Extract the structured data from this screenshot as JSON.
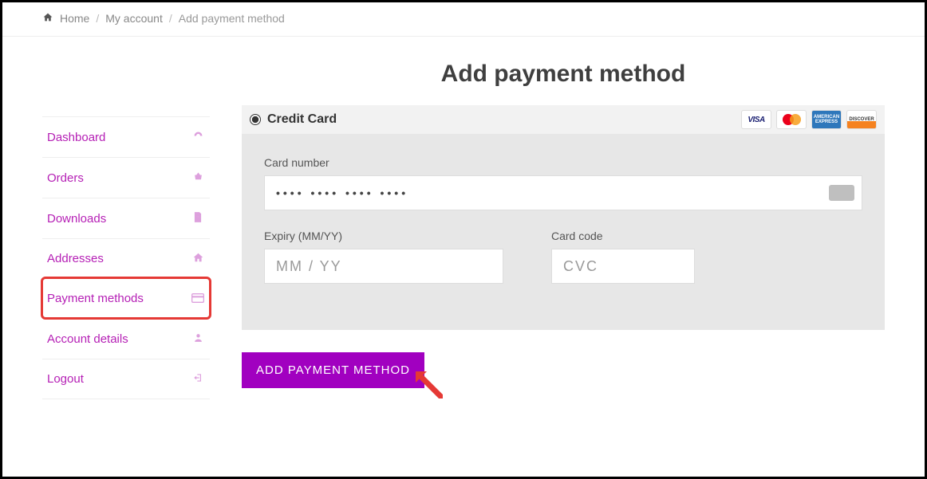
{
  "breadcrumb": {
    "home": "Home",
    "account": "My account",
    "current": "Add payment method"
  },
  "sidebar": {
    "items": [
      {
        "label": "Dashboard",
        "icon": "dashboard-icon"
      },
      {
        "label": "Orders",
        "icon": "basket-icon"
      },
      {
        "label": "Downloads",
        "icon": "file-icon"
      },
      {
        "label": "Addresses",
        "icon": "house-icon"
      },
      {
        "label": "Payment methods",
        "icon": "card-icon"
      },
      {
        "label": "Account details",
        "icon": "user-icon"
      },
      {
        "label": "Logout",
        "icon": "logout-icon"
      }
    ]
  },
  "page": {
    "title": "Add payment method"
  },
  "payment_method": {
    "radio_label": "Credit Card",
    "brands": [
      "VISA",
      "mastercard",
      "AMERICAN EXPRESS",
      "DISCOVER"
    ]
  },
  "form": {
    "card_number_label": "Card number",
    "card_number_value": "•••• •••• •••• ••••",
    "expiry_label": "Expiry (MM/YY)",
    "expiry_placeholder": "MM / YY",
    "cvc_label": "Card code",
    "cvc_placeholder": "CVC"
  },
  "button": {
    "submit": "ADD PAYMENT METHOD"
  },
  "colors": {
    "accent": "#a100c0",
    "link": "#b51fb5",
    "highlight": "#e53935"
  }
}
